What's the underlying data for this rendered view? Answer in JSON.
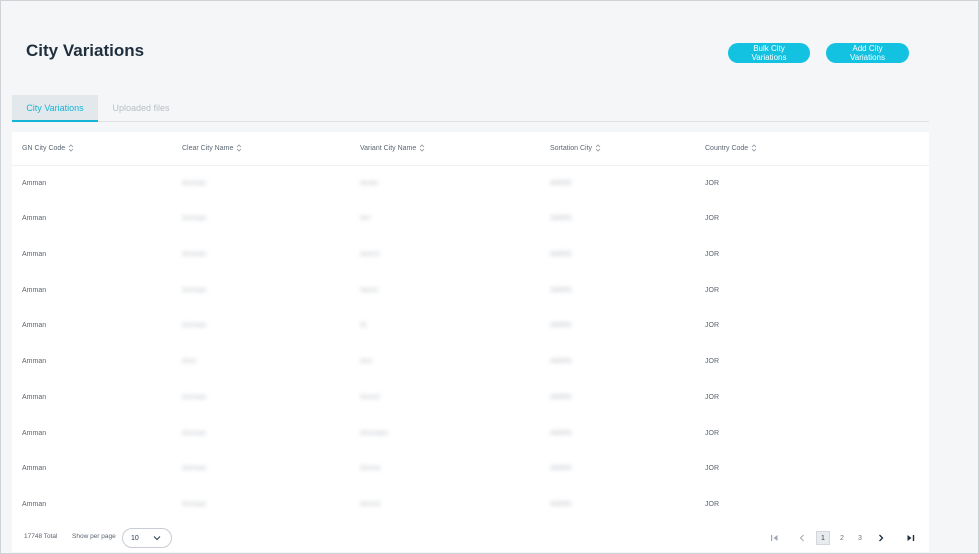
{
  "header": {
    "title": "City Variations",
    "bulk_button": "Bulk City Variations",
    "add_button": "Add City Variations"
  },
  "tabs": [
    {
      "label": "City Variations",
      "active": true
    },
    {
      "label": "Uploaded files",
      "active": false
    }
  ],
  "table": {
    "columns": [
      "GN City Code",
      "Clear City Name",
      "Variant City Name",
      "Sortation City",
      "Country Code"
    ],
    "rows": [
      {
        "gn": "Amman",
        "clear": "Amman",
        "variant": "Aman",
        "sortation": "AMMN",
        "country": "JOR"
      },
      {
        "gn": "Amman",
        "clear": "Amman",
        "variant": "Am",
        "sortation": "AMMN",
        "country": "JOR"
      },
      {
        "gn": "Amman",
        "clear": "Amman",
        "variant": "Amm1",
        "sortation": "AMMN",
        "country": "JOR"
      },
      {
        "gn": "Amman",
        "clear": "Amman",
        "variant": "Aamn",
        "sortation": "AMMN",
        "country": "JOR"
      },
      {
        "gn": "Amman",
        "clear": "Amman",
        "variant": "Al",
        "sortation": "AMMN",
        "country": "JOR"
      },
      {
        "gn": "Amman",
        "clear": "Amn",
        "variant": "Ann",
        "sortation": "AMMN",
        "country": "JOR"
      },
      {
        "gn": "Amman",
        "clear": "Amman",
        "variant": "Amm2",
        "sortation": "AMMN",
        "country": "JOR"
      },
      {
        "gn": "Amman",
        "clear": "Amman",
        "variant": "Ammaan",
        "sortation": "AMMN",
        "country": "JOR"
      },
      {
        "gn": "Amman",
        "clear": "Amman",
        "variant": "Amma",
        "sortation": "AMMN",
        "country": "JOR"
      },
      {
        "gn": "Amman",
        "clear": "Amman",
        "variant": "Amm3",
        "sortation": "AMMN",
        "country": "JOR"
      }
    ]
  },
  "footer": {
    "total": "17748 Total",
    "per_page_label": "Show per page",
    "per_page_value": "10",
    "pages": [
      "1",
      "2",
      "3"
    ],
    "current_page": "1"
  },
  "colors": {
    "accent": "#13c1e0",
    "title": "#1f2f3d"
  }
}
